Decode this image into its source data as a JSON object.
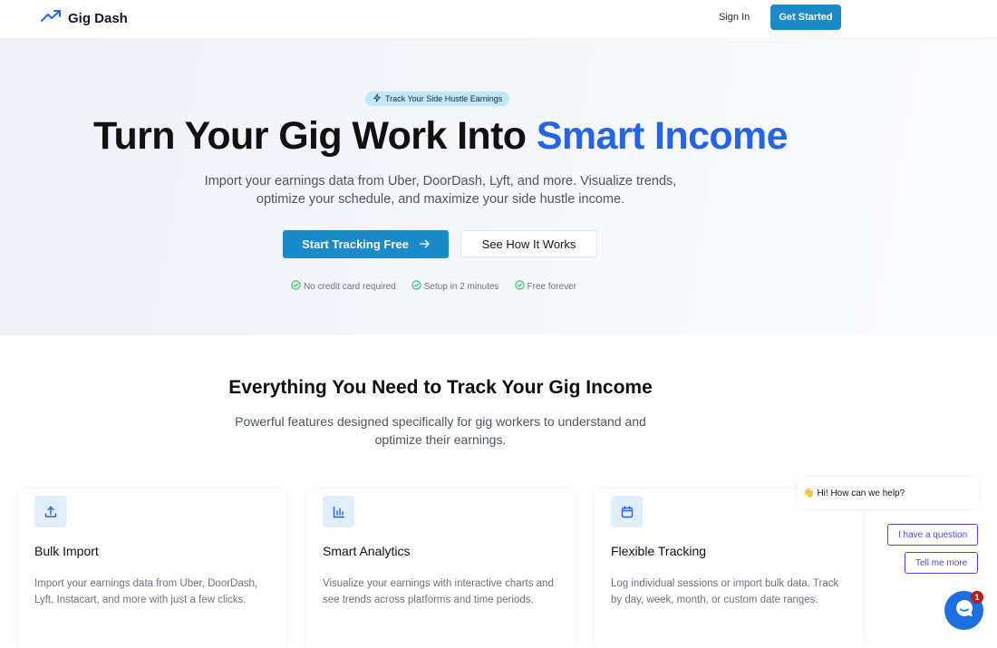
{
  "nav": {
    "brand": "Gig Dash",
    "sign_in": "Sign In",
    "get_started": "Get Started"
  },
  "hero": {
    "pill": "Track Your Side Hustle Earnings",
    "headline_lead": "Turn Your Gig Work Into ",
    "headline_accent": "Smart Income",
    "subtext": "Import your earnings data from Uber, DoorDash, Lyft, and more. Visualize trends, optimize your schedule, and maximize your side hustle income.",
    "cta_primary": "Start Tracking Free",
    "cta_secondary": "See How It Works",
    "checks": [
      "No credit card required",
      "Setup in 2 minutes",
      "Free forever"
    ]
  },
  "features": {
    "title": "Everything You Need to Track Your Gig Income",
    "subtitle": "Powerful features designed specifically for gig workers to understand and optimize their earnings.",
    "cards": [
      {
        "icon": "upload-icon",
        "title": "Bulk Import",
        "desc": "Import your earnings data from Uber, DoorDash, Lyft, Instacart, and more with just a few clicks."
      },
      {
        "icon": "bar-chart-icon",
        "title": "Smart Analytics",
        "desc": "Visualize your earnings with interactive charts and see trends across platforms and time periods."
      },
      {
        "icon": "calendar-icon",
        "title": "Flexible Tracking",
        "desc": "Log individual sessions or import bulk data. Track by day, week, month, or custom date ranges."
      }
    ]
  },
  "chat": {
    "wave": "👋",
    "greeting": "Hi! How can we help?",
    "options": [
      "I have a question",
      "Tell me more"
    ],
    "badge": "1"
  },
  "colors": {
    "primary": "#1a8ac9",
    "accent": "#2563eb",
    "chat": "#1d6fe0",
    "chat_option": "#4f46e5",
    "success": "#22c55e"
  }
}
